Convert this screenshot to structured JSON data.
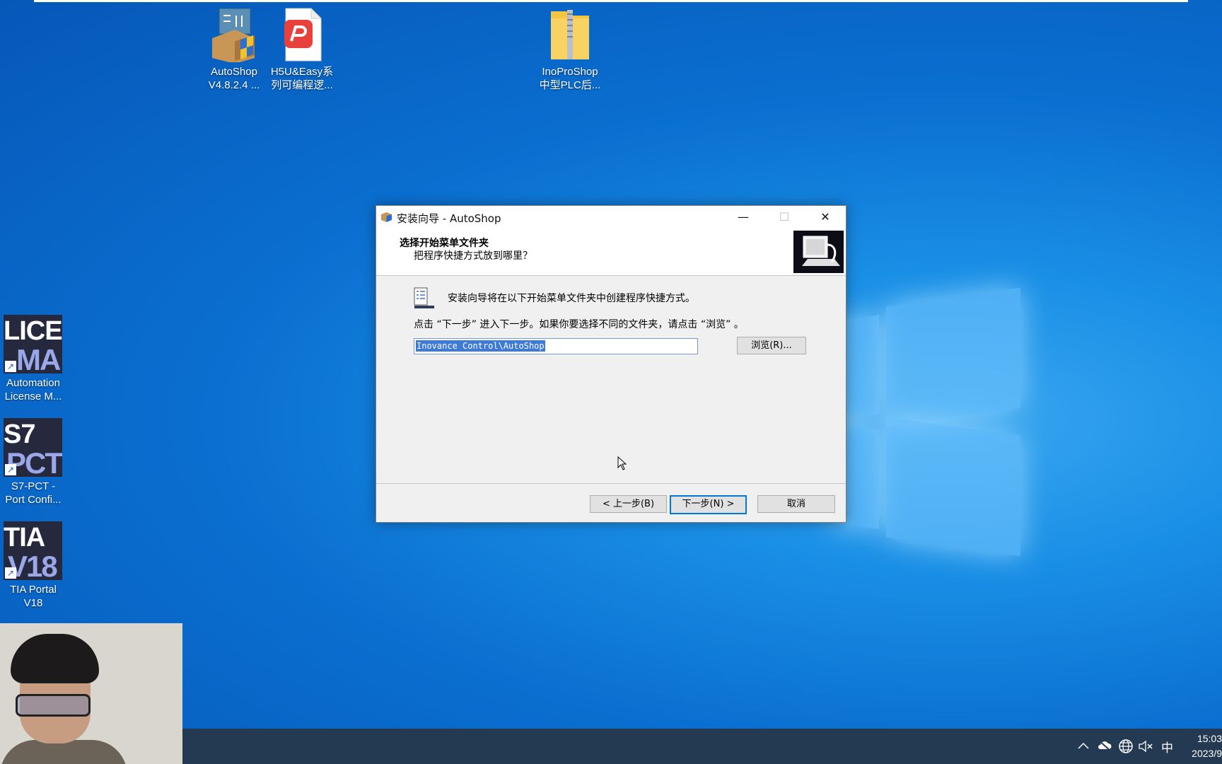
{
  "desktop": {
    "icons_top": [
      {
        "line1": "AutoShop",
        "line2": "V4.8.2.4 ..."
      },
      {
        "line1": "H5U&Easy系",
        "line2": "列可编程逻..."
      },
      {
        "line1": "InoProShop",
        "line2": "中型PLC后..."
      }
    ],
    "icons_left": [
      {
        "tile1": "LICEN",
        "tile2": "MA",
        "line1": "Automation",
        "line2": "License M..."
      },
      {
        "tile1": "S7",
        "tile2": "PCT",
        "line1": "S7-PCT -",
        "line2": "Port Confi..."
      },
      {
        "tile1": "TIA",
        "tile2": "V18",
        "line1": "TIA Portal",
        "line2": "V18"
      }
    ]
  },
  "dialog": {
    "title": "安装向导 - AutoShop",
    "minimize": "—",
    "maximize": "☐",
    "close": "✕",
    "heading": "选择开始菜单文件夹",
    "subheading": "把程序快捷方式放到哪里？",
    "description": "安装向导将在以下开始菜单文件夹中创建程序快捷方式。",
    "instruction": "点击 “下一步” 进入下一步。如果你要选择不同的文件夹，请点击 “浏览” 。",
    "folder_value": "Inovance Control\\AutoShop",
    "browse_label": "浏览(R)...",
    "back_label": "< 上一步(B)",
    "next_label": "下一步(N) >",
    "cancel_label": "取消"
  },
  "taskbar": {
    "tray_icons": [
      "chevron-up-icon",
      "cloud-off-icon",
      "globe-icon",
      "volume-muted-icon"
    ],
    "ime": "中",
    "time": "15:03",
    "date": "2023/9"
  }
}
